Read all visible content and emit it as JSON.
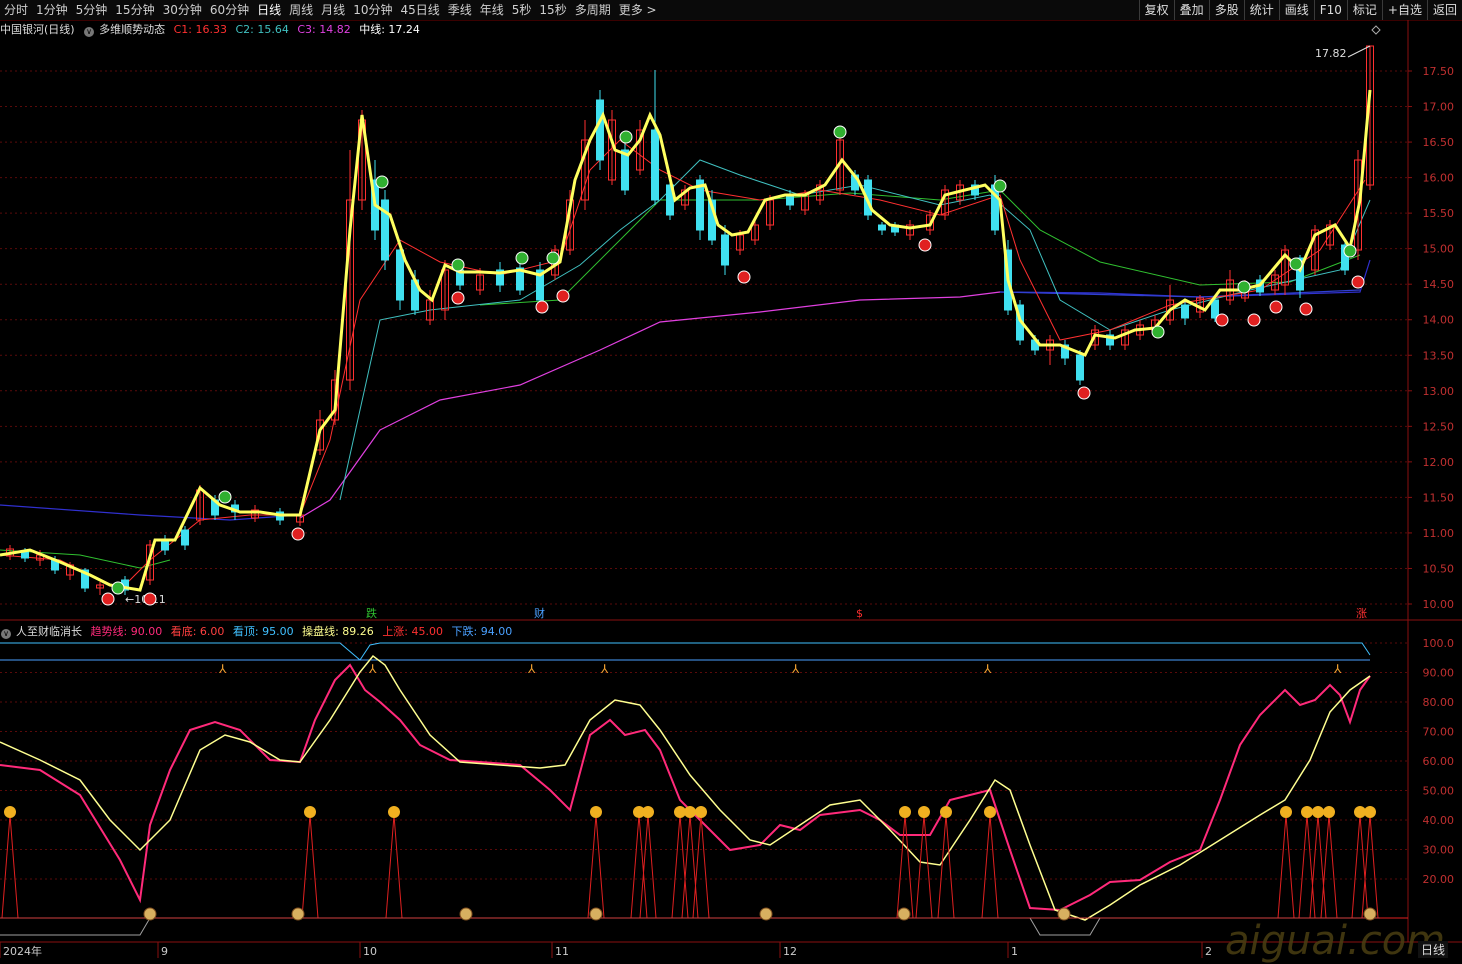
{
  "toolbar": {
    "timeframes": [
      "分时",
      "1分钟",
      "5分钟",
      "15分钟",
      "30分钟",
      "60分钟",
      "日线",
      "周线",
      "月线",
      "10分钟",
      "45日线",
      "季线",
      "年线",
      "5秒",
      "15秒",
      "多周期",
      "更多 >"
    ],
    "active_index": 6,
    "right_buttons": [
      "复权",
      "叠加",
      "多股",
      "统计",
      "画线",
      "F10",
      "标记",
      "+自选",
      "返回"
    ]
  },
  "main_panel": {
    "stock_name": "中国银河(日线)",
    "indicator_name": "多维顺势动态",
    "c1_label": "C1: 16.33",
    "c2_label": "C2: 15.64",
    "c3_label": "C3: 14.82",
    "mid_label": "中线: 17.24",
    "max_price_label": "17.82",
    "min_price_label": "10.11",
    "y_ticks": [
      "17.50",
      "17.00",
      "16.50",
      "16.00",
      "15.50",
      "15.00",
      "14.50",
      "14.00",
      "13.50",
      "13.00",
      "12.50",
      "12.00",
      "11.50",
      "11.00",
      "10.50",
      "10.00"
    ],
    "markers": [
      "跌",
      "财",
      "$",
      "涨"
    ],
    "colors": {
      "c1": "#ff3030",
      "c2": "#40c0c0",
      "c3": "#e040e0",
      "mid": "#ffffff"
    }
  },
  "sub_panel": {
    "indicator_name": "人至财临消长",
    "trend_label": "趋势线: 90.00",
    "bottom_label": "看底: 6.00",
    "top_label": "看顶: 95.00",
    "op_label": "操盘线: 89.26",
    "up_label": "上涨: 45.00",
    "down_label": "下跌: 94.00",
    "y_ticks": [
      "100.0",
      "90.00",
      "80.00",
      "70.00",
      "60.00",
      "50.00",
      "40.00",
      "30.00",
      "20.00"
    ],
    "colors": {
      "trend": "#ff2a7a",
      "bottom": "#ff4040",
      "top": "#40c0ff",
      "op": "#ffff90",
      "up": "#ff3030",
      "down": "#4aa0ff"
    }
  },
  "x_axis": {
    "labels": [
      "2024年",
      "9",
      "10",
      "11",
      "12",
      "1",
      "2"
    ]
  },
  "period_label": "日线",
  "watermark": "aiguai.com"
}
